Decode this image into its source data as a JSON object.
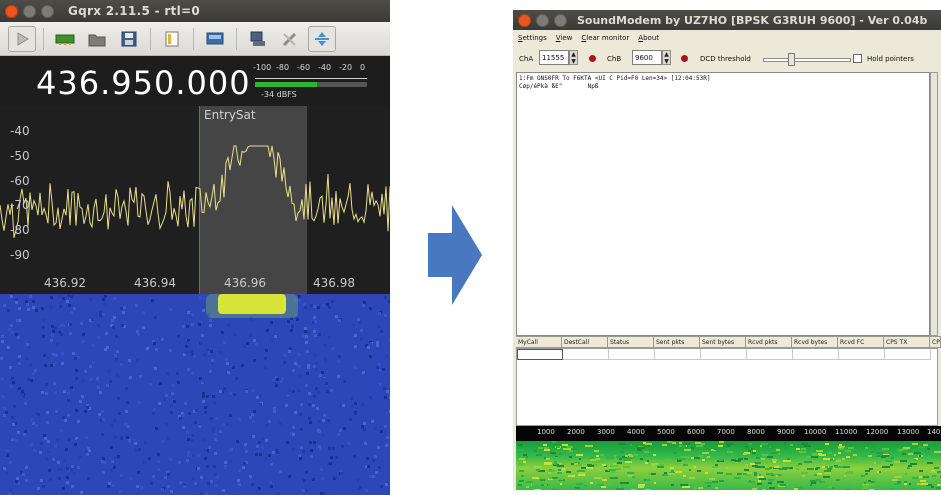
{
  "gqrx": {
    "title": "Gqrx 2.11.5 - rtl=0",
    "frequency": "436.950.000",
    "smeter": {
      "scale_labels": [
        "-100",
        "-80",
        "-60",
        "-40",
        "-20",
        "0"
      ],
      "level_text": "-34 dBFS",
      "level_fraction": 0.55
    },
    "plot": {
      "y_labels": [
        "-40",
        "-50",
        "-60",
        "-70",
        "-80",
        "-90"
      ],
      "x_labels": [
        "436.92",
        "436.94",
        "436.96",
        "436.98"
      ],
      "filter_label": "EntrySat"
    },
    "toolbar_icons": [
      "play-icon",
      "hardware-icon",
      "open-folder-icon",
      "save-icon",
      "document-icon",
      "monitor-icon",
      "network-icon",
      "tools-icon",
      "center-icon"
    ]
  },
  "soundmodem": {
    "title": "SoundModem by UZ7HO [BPSK G3RUH 9600] - Ver 0.04b",
    "menu": [
      "Settings",
      "View",
      "Clear monitor",
      "About"
    ],
    "cha_label": "ChA",
    "cha_value": "11555",
    "chb_label": "ChB",
    "chb_value": "9600",
    "dcd_label": "DCD threshold",
    "hold_label": "Hold pointers",
    "monitor_lines": [
      "1:Fm ONS0FR To F6KTA <UI C Pid=F0 Len=34> [12:04:53R]",
      "Cøp/éPkà ßE\"       Npß"
    ],
    "columns": [
      "MyCall",
      "DestCall",
      "Status",
      "Sent pkts",
      "Sent bytes",
      "Rcvd pkts",
      "Rcvd bytes",
      "Rcvd FC",
      "CPS TX",
      "CP"
    ],
    "scale_labels": [
      "1000",
      "2000",
      "3000",
      "4000",
      "5000",
      "6000",
      "7000",
      "8000",
      "9000",
      "10000",
      "11000",
      "12000",
      "13000",
      "140"
    ]
  },
  "colors": {
    "gqrx_trace": "#e8e08a",
    "waterfall_base": "#2d47b8",
    "arrow": "#4a78c0",
    "led": "#a11a1a"
  }
}
